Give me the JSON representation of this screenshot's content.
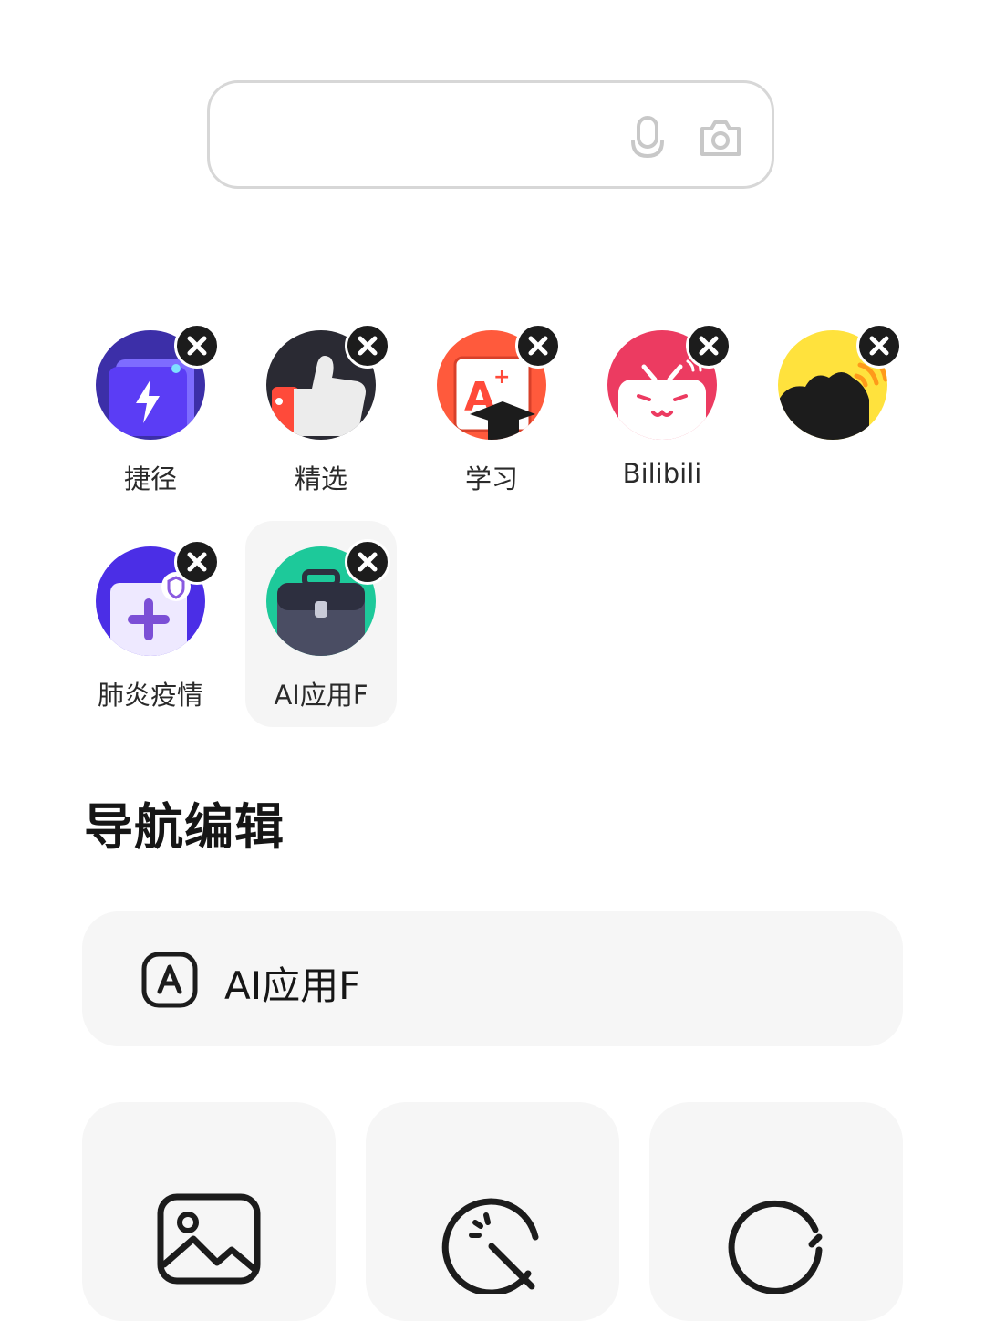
{
  "search": {
    "value": "",
    "placeholder": "",
    "mic_icon": "microphone-icon",
    "camera_icon": "camera-icon"
  },
  "apps": [
    {
      "label": "捷径",
      "icon": "shortcut-lightning-icon",
      "color": "#5b3df5"
    },
    {
      "label": "精选",
      "icon": "thumbs-up-icon",
      "color": "#2a2a33"
    },
    {
      "label": "学习",
      "icon": "study-aplus-icon",
      "color": "#ff5a3c"
    },
    {
      "label": "Bilibili",
      "icon": "bilibili-tv-icon",
      "color": "#ec3b61"
    },
    {
      "label": "",
      "icon": "yellow-voice-icon",
      "color": "#ffe23d"
    },
    {
      "label": "肺炎疫情",
      "icon": "medical-plus-icon",
      "color": "#4b2ee6"
    },
    {
      "label": "AI应用F",
      "icon": "toolbox-icon",
      "color": "#1dc99a",
      "selected": true
    }
  ],
  "section_title": "导航编辑",
  "name_row": {
    "icon": "letter-a-badge-icon",
    "label": "AI应用F"
  },
  "options": [
    {
      "icon": "image-icon"
    },
    {
      "icon": "sticker-icon"
    },
    {
      "icon": "refresh-icon"
    }
  ]
}
